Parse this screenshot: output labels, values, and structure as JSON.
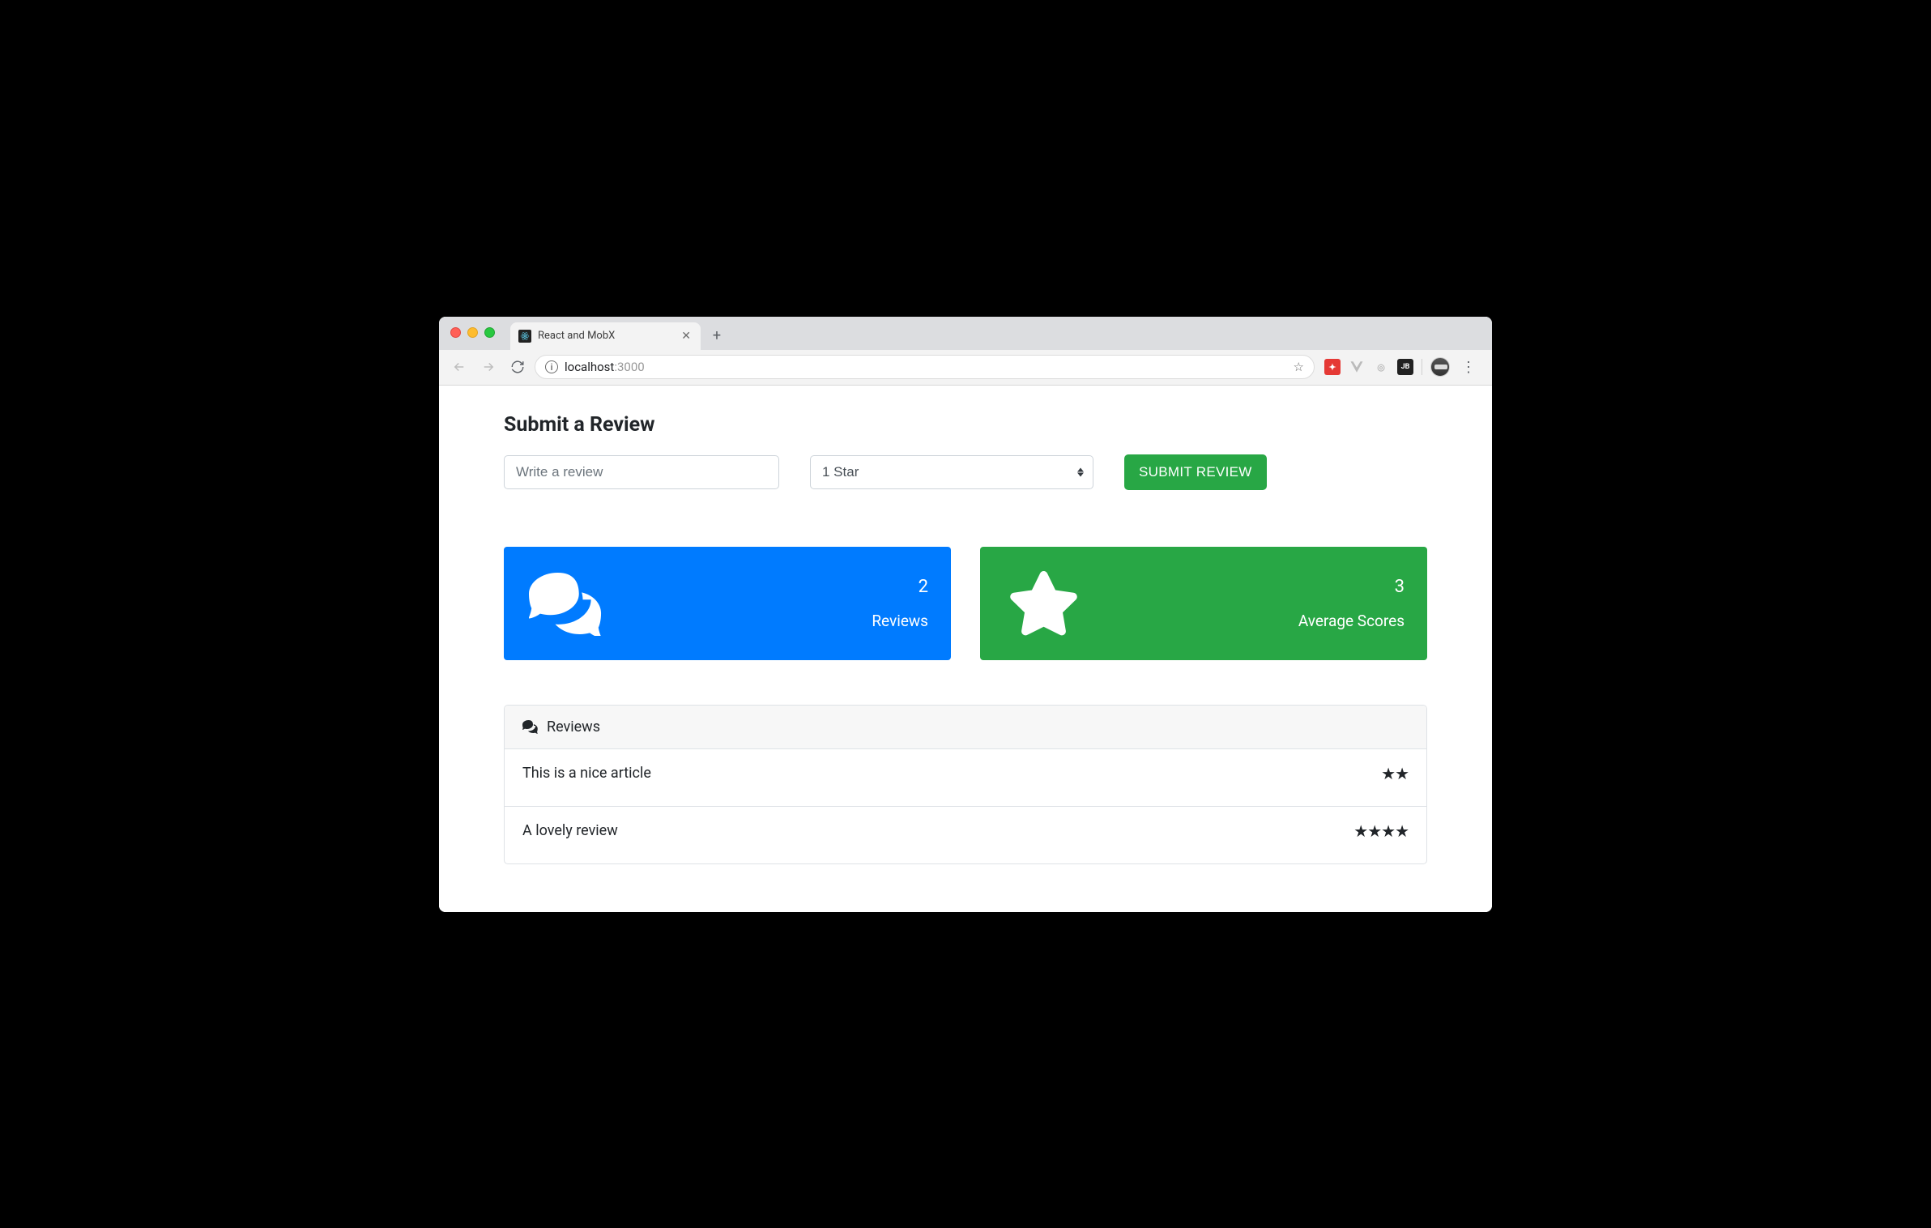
{
  "browser": {
    "tab_title": "React and MobX",
    "url_host": "localhost",
    "url_port": ":3000"
  },
  "page": {
    "title": "Submit a Review",
    "review_input_placeholder": "Write a review",
    "star_select_value": "1 Star",
    "submit_label": "SUBMIT REVIEW"
  },
  "stats": {
    "reviews": {
      "value": "2",
      "label": "Reviews"
    },
    "average": {
      "value": "3",
      "label": "Average Scores"
    }
  },
  "panel": {
    "title": "Reviews",
    "items": [
      {
        "text": "This is a nice article",
        "stars": "★★"
      },
      {
        "text": "A lovely review",
        "stars": "★★★★"
      }
    ]
  }
}
